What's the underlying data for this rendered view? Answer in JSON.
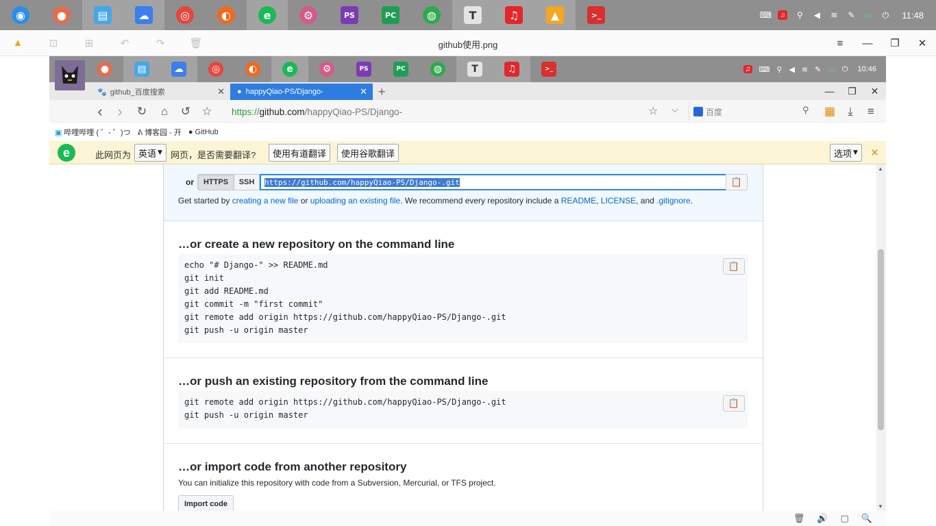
{
  "outer_taskbar": {
    "apps": [
      {
        "name": "deepin-launcher-icon",
        "glyph": "◉",
        "bg": "#2c8ee8",
        "shape": "circle"
      },
      {
        "name": "screen-recorder-icon",
        "glyph": "●",
        "bg": "#ea6a4c",
        "shape": "circle"
      },
      {
        "name": "file-manager-icon",
        "glyph": "▤",
        "bg": "#45a8e6",
        "shape": "sq"
      },
      {
        "name": "baidu-netdisk-icon",
        "glyph": "☁",
        "bg": "#3a7ef0",
        "shape": "sq"
      },
      {
        "name": "chrome-icon",
        "glyph": "◎",
        "bg": "#e8453c",
        "shape": "circle"
      },
      {
        "name": "firefox-icon",
        "glyph": "◐",
        "bg": "#f06a1d",
        "shape": "circle"
      },
      {
        "name": "browser-e-icon",
        "glyph": "e",
        "bg": "#19b955",
        "shape": "circle"
      },
      {
        "name": "settings-icon",
        "glyph": "⚙",
        "bg": "#d45a8a",
        "shape": "circle"
      },
      {
        "name": "phpstorm-icon",
        "glyph": "PS",
        "bg": "#7d3bb3",
        "shape": "sq"
      },
      {
        "name": "pycharm-icon",
        "glyph": "PC",
        "bg": "#1f9d55",
        "shape": "sq"
      },
      {
        "name": "wechat-icon",
        "glyph": "◍",
        "bg": "#2ea94b",
        "shape": "circle"
      },
      {
        "name": "typora-icon",
        "glyph": "T",
        "bg": "#e4e4e4",
        "shape": "sq",
        "fg": "#333"
      },
      {
        "name": "netease-music-icon",
        "glyph": "♫",
        "bg": "#e3262b",
        "shape": "sq"
      },
      {
        "name": "image-viewer-icon",
        "glyph": "▲",
        "bg": "#f5a623",
        "shape": "sq"
      },
      {
        "name": "terminal-icon",
        "glyph": ">_",
        "bg": "#d92f2f",
        "shape": "sq"
      }
    ],
    "tray": {
      "keyboard": "⌨",
      "music": "♫",
      "usb": "⚲",
      "volume": "◀",
      "wifi": "≋",
      "pen": "✎",
      "battery": "▭",
      "power": "⏻",
      "clock": "11:48"
    }
  },
  "viewer": {
    "title": "github使用.png",
    "tools": [
      "▲",
      "⊡",
      "⊞",
      "↶",
      "↷",
      "🗑"
    ],
    "menu": "≡",
    "minimize": "—",
    "maximize": "❐",
    "close": "✕",
    "bottom_tools": [
      "🗑",
      "🔊",
      "▢",
      "🔍"
    ]
  },
  "inner_taskbar": {
    "clock": "10:46",
    "tray": [
      "♫",
      "⌨",
      "⚲",
      "◀",
      "≋",
      "✎",
      "▭",
      "⏻"
    ]
  },
  "browser": {
    "tabs": [
      {
        "label": "github_百度搜索",
        "favicon": "🐾"
      },
      {
        "label": "happyQiao-PS/Django-",
        "favicon": "●"
      }
    ],
    "new_tab": "+",
    "win_controls": {
      "minimize": "—",
      "restore": "❐",
      "close": "✕"
    },
    "nav": {
      "back": "‹",
      "forward": "›",
      "reload": "↻",
      "home": "⌂",
      "undo": "↺",
      "star": "☆"
    },
    "url": {
      "scheme": "https://",
      "host": "github.com",
      "path": "/happyQiao-PS/Django-"
    },
    "url_star": "☆",
    "url_dropdown": "⌵",
    "search": {
      "engine": "百度",
      "glass": "⚲"
    },
    "right_tools": {
      "apps": "▦",
      "download": "⤓",
      "menu": "≡"
    },
    "bookmarks": [
      {
        "label": "哔哩哔哩 ( ゜- ゜)つ",
        "icon": "▣"
      },
      {
        "label": "博客园 - 开",
        "icon": "ᕕ"
      },
      {
        "label": "GitHub",
        "icon": "●"
      }
    ],
    "translate_bar": {
      "prefix": "此网页为",
      "language": "英语",
      "suffix": "网页，是否需要翻译?",
      "youdao": "使用有道翻译",
      "google": "使用谷歌翻译",
      "options": "选项",
      "close": "✕"
    }
  },
  "github": {
    "quick_setup": {
      "or": "or",
      "https": "HTTPS",
      "ssh": "SSH",
      "clone_url": "https://github.com/happyQiao-PS/Django-.git",
      "help_pre": "Get started by ",
      "help_link1": "creating a new file",
      "help_mid1": " or ",
      "help_link2": "uploading an existing file",
      "help_mid2": ". We recommend every repository include a ",
      "help_link3": "README",
      "help_comma": ", ",
      "help_link4": "LICENSE",
      "help_and": ", and ",
      "help_link5": ".gitignore",
      "help_end": "."
    },
    "create_section": {
      "title": "…or create a new repository on the command line",
      "lines": [
        "echo \"# Django-\" >> README.md",
        "git init",
        "git add README.md",
        "git commit -m \"first commit\"",
        "git remote add origin https://github.com/happyQiao-PS/Django-.git",
        "git push -u origin master"
      ]
    },
    "push_section": {
      "title": "…or push an existing repository from the command line",
      "lines": [
        "git remote add origin https://github.com/happyQiao-PS/Django-.git",
        "git push -u origin master"
      ]
    },
    "import_section": {
      "title": "…or import code from another repository",
      "description": "You can initialize this repository with code from a Subversion, Mercurial, or TFS project.",
      "button": "Import code"
    },
    "copy_icon": "📋"
  }
}
